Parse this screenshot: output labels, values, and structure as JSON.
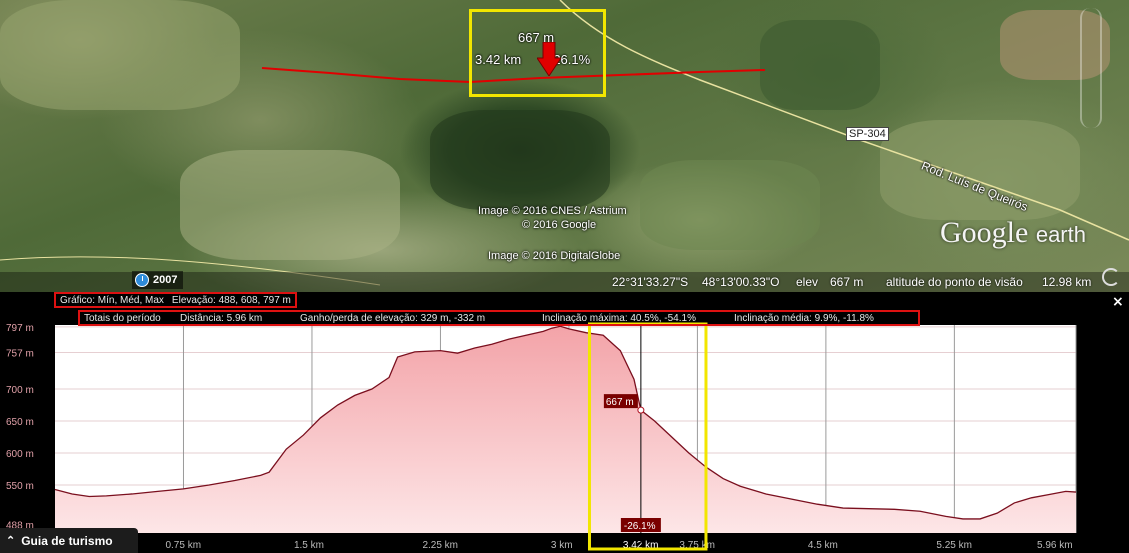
{
  "map": {
    "highway_label": "SP-304",
    "road_name": "Rod. Luís de Queirós",
    "credits": [
      "Image © 2016 CNES / Astrium",
      "© 2016 Google",
      "Image © 2016 DigitalGlobe"
    ],
    "logo_main": "Google",
    "logo_sub": "earth",
    "year": "2007",
    "marker": {
      "elevation": "667 m",
      "distance": "3.42 km",
      "slope": "-26.1%"
    },
    "status": {
      "lat": "22°31'33.27\"S",
      "lon": "48°13'00.33\"O",
      "elev_label": "elev",
      "elev_value": "667 m",
      "eye_label": "altitude do ponto de visão",
      "eye_value": "12.98 km"
    },
    "track_color": "#e00000",
    "highlight_color": "#f2e600"
  },
  "panel": {
    "summary": {
      "label": "Gráfico: Mín, Méd, Max",
      "value": "Elevação: 488, 608, 797 m"
    },
    "totals": {
      "label": "Totais do período",
      "distance": "Distância: 5.96 km",
      "gain_loss": "Ganho/perda de elevação: 329 m, -332 m",
      "max_slope": "Inclinação máxima: 40.5%, -54.1%",
      "avg_slope": "Inclinação média: 9.9%, -11.8%"
    },
    "close_symbol": "×",
    "guide_tab": "Guia de turismo",
    "guide_caret": "⌃"
  },
  "chart_data": {
    "type": "area",
    "xlabel": "",
    "ylabel": "",
    "ylim": [
      475,
      800
    ],
    "xlim": [
      0,
      5.96
    ],
    "y_ticks": [
      {
        "value": 797,
        "label": "797 m"
      },
      {
        "value": 757,
        "label": "757 m"
      },
      {
        "value": 700,
        "label": "700 m"
      },
      {
        "value": 650,
        "label": "650 m"
      },
      {
        "value": 600,
        "label": "600 m"
      },
      {
        "value": 550,
        "label": "550 m"
      },
      {
        "value": 488,
        "label": "488 m"
      }
    ],
    "x_ticks": [
      {
        "value": 0.75,
        "label": "0.75 km"
      },
      {
        "value": 1.5,
        "label": "1.5 km"
      },
      {
        "value": 2.25,
        "label": "2.25 km"
      },
      {
        "value": 3.0,
        "label": "3 km"
      },
      {
        "value": 3.42,
        "label": "3.42 km"
      },
      {
        "value": 3.75,
        "label": "3.75 km"
      },
      {
        "value": 4.5,
        "label": "4.5 km"
      },
      {
        "value": 5.25,
        "label": "5.25 km"
      },
      {
        "value": 5.96,
        "label": "5.96 km"
      }
    ],
    "series": [
      {
        "x": [
          0,
          0.1,
          0.2,
          0.3,
          0.45,
          0.6,
          0.75,
          0.9,
          1.05,
          1.2,
          1.25,
          1.35,
          1.45,
          1.55,
          1.65,
          1.75,
          1.85,
          1.95,
          2.0,
          2.1,
          2.25,
          2.35,
          2.45,
          2.55,
          2.65,
          2.75,
          2.85,
          2.9,
          2.95,
          3.0,
          3.1,
          3.2,
          3.3,
          3.38,
          3.42,
          3.5,
          3.6,
          3.7,
          3.8,
          3.9,
          4.0,
          4.15,
          4.3,
          4.45,
          4.6,
          4.75,
          4.9,
          5.05,
          5.2,
          5.3,
          5.4,
          5.5,
          5.6,
          5.7,
          5.8,
          5.9,
          5.96
        ],
        "y": [
          543,
          536,
          532,
          533,
          536,
          540,
          544,
          550,
          557,
          565,
          570,
          606,
          628,
          655,
          675,
          690,
          700,
          718,
          750,
          758,
          760,
          756,
          764,
          770,
          778,
          784,
          790,
          795,
          798,
          794,
          788,
          784,
          760,
          715,
          667,
          650,
          625,
          600,
          578,
          560,
          548,
          536,
          528,
          520,
          514,
          513,
          512,
          509,
          501,
          497,
          497,
          506,
          522,
          530,
          535,
          540,
          539
        ]
      }
    ],
    "cursor": {
      "x": 3.42,
      "y": 667,
      "elevation_label": "667 m",
      "slope_label": "-26.1%"
    },
    "selection": {
      "x_start": 3.12,
      "x_end": 3.8
    },
    "line_color": "#7a0f1e",
    "fill_top_color": "#f3a3a8",
    "fill_bottom_color": "#fde6e7",
    "plot_bg_color": "#ffffff",
    "grid": true
  }
}
